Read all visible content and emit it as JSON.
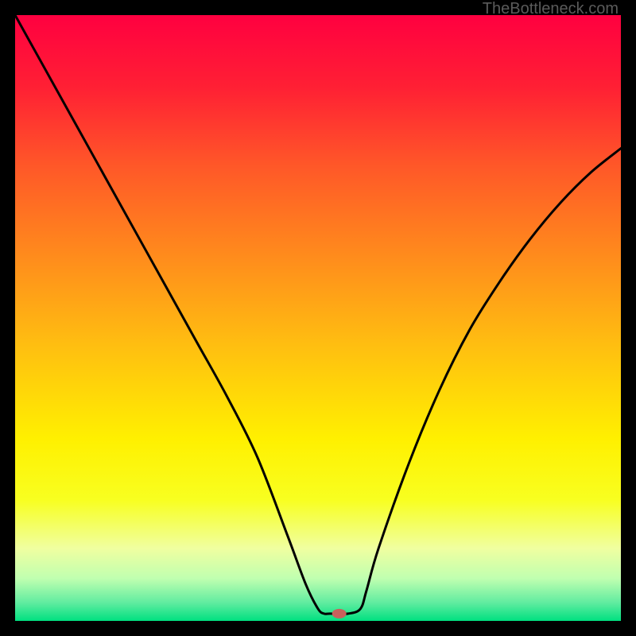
{
  "watermark": "TheBottleneck.com",
  "chart_data": {
    "type": "line",
    "title": "",
    "xlabel": "",
    "ylabel": "",
    "xlim": [
      0,
      100
    ],
    "ylim": [
      0,
      100
    ],
    "background_gradient": {
      "stops": [
        {
          "offset": 0.0,
          "color": "#ff0040"
        },
        {
          "offset": 0.12,
          "color": "#ff2034"
        },
        {
          "offset": 0.25,
          "color": "#ff5828"
        },
        {
          "offset": 0.4,
          "color": "#ff8c1c"
        },
        {
          "offset": 0.55,
          "color": "#ffc010"
        },
        {
          "offset": 0.7,
          "color": "#fff000"
        },
        {
          "offset": 0.8,
          "color": "#f8ff20"
        },
        {
          "offset": 0.88,
          "color": "#f0ffa0"
        },
        {
          "offset": 0.93,
          "color": "#c0ffb0"
        },
        {
          "offset": 0.97,
          "color": "#60eca0"
        },
        {
          "offset": 1.0,
          "color": "#00e080"
        }
      ]
    },
    "series": [
      {
        "name": "bottleneck-curve",
        "color": "#000000",
        "x": [
          0,
          5,
          10,
          15,
          20,
          25,
          30,
          35,
          40,
          45,
          48,
          50,
          51,
          52,
          55,
          57,
          58,
          60,
          65,
          70,
          75,
          80,
          85,
          90,
          95,
          100
        ],
        "y": [
          100,
          91,
          82,
          73,
          64,
          55,
          46,
          37,
          27,
          14,
          6,
          2,
          1.2,
          1.2,
          1.2,
          2,
          5,
          12,
          26,
          38,
          48,
          56,
          63,
          69,
          74,
          78
        ]
      }
    ],
    "marker": {
      "name": "min-bottleneck-pill",
      "x": 53.5,
      "y": 1.2,
      "color": "#c8605c",
      "rx": 9,
      "ry": 6
    }
  }
}
